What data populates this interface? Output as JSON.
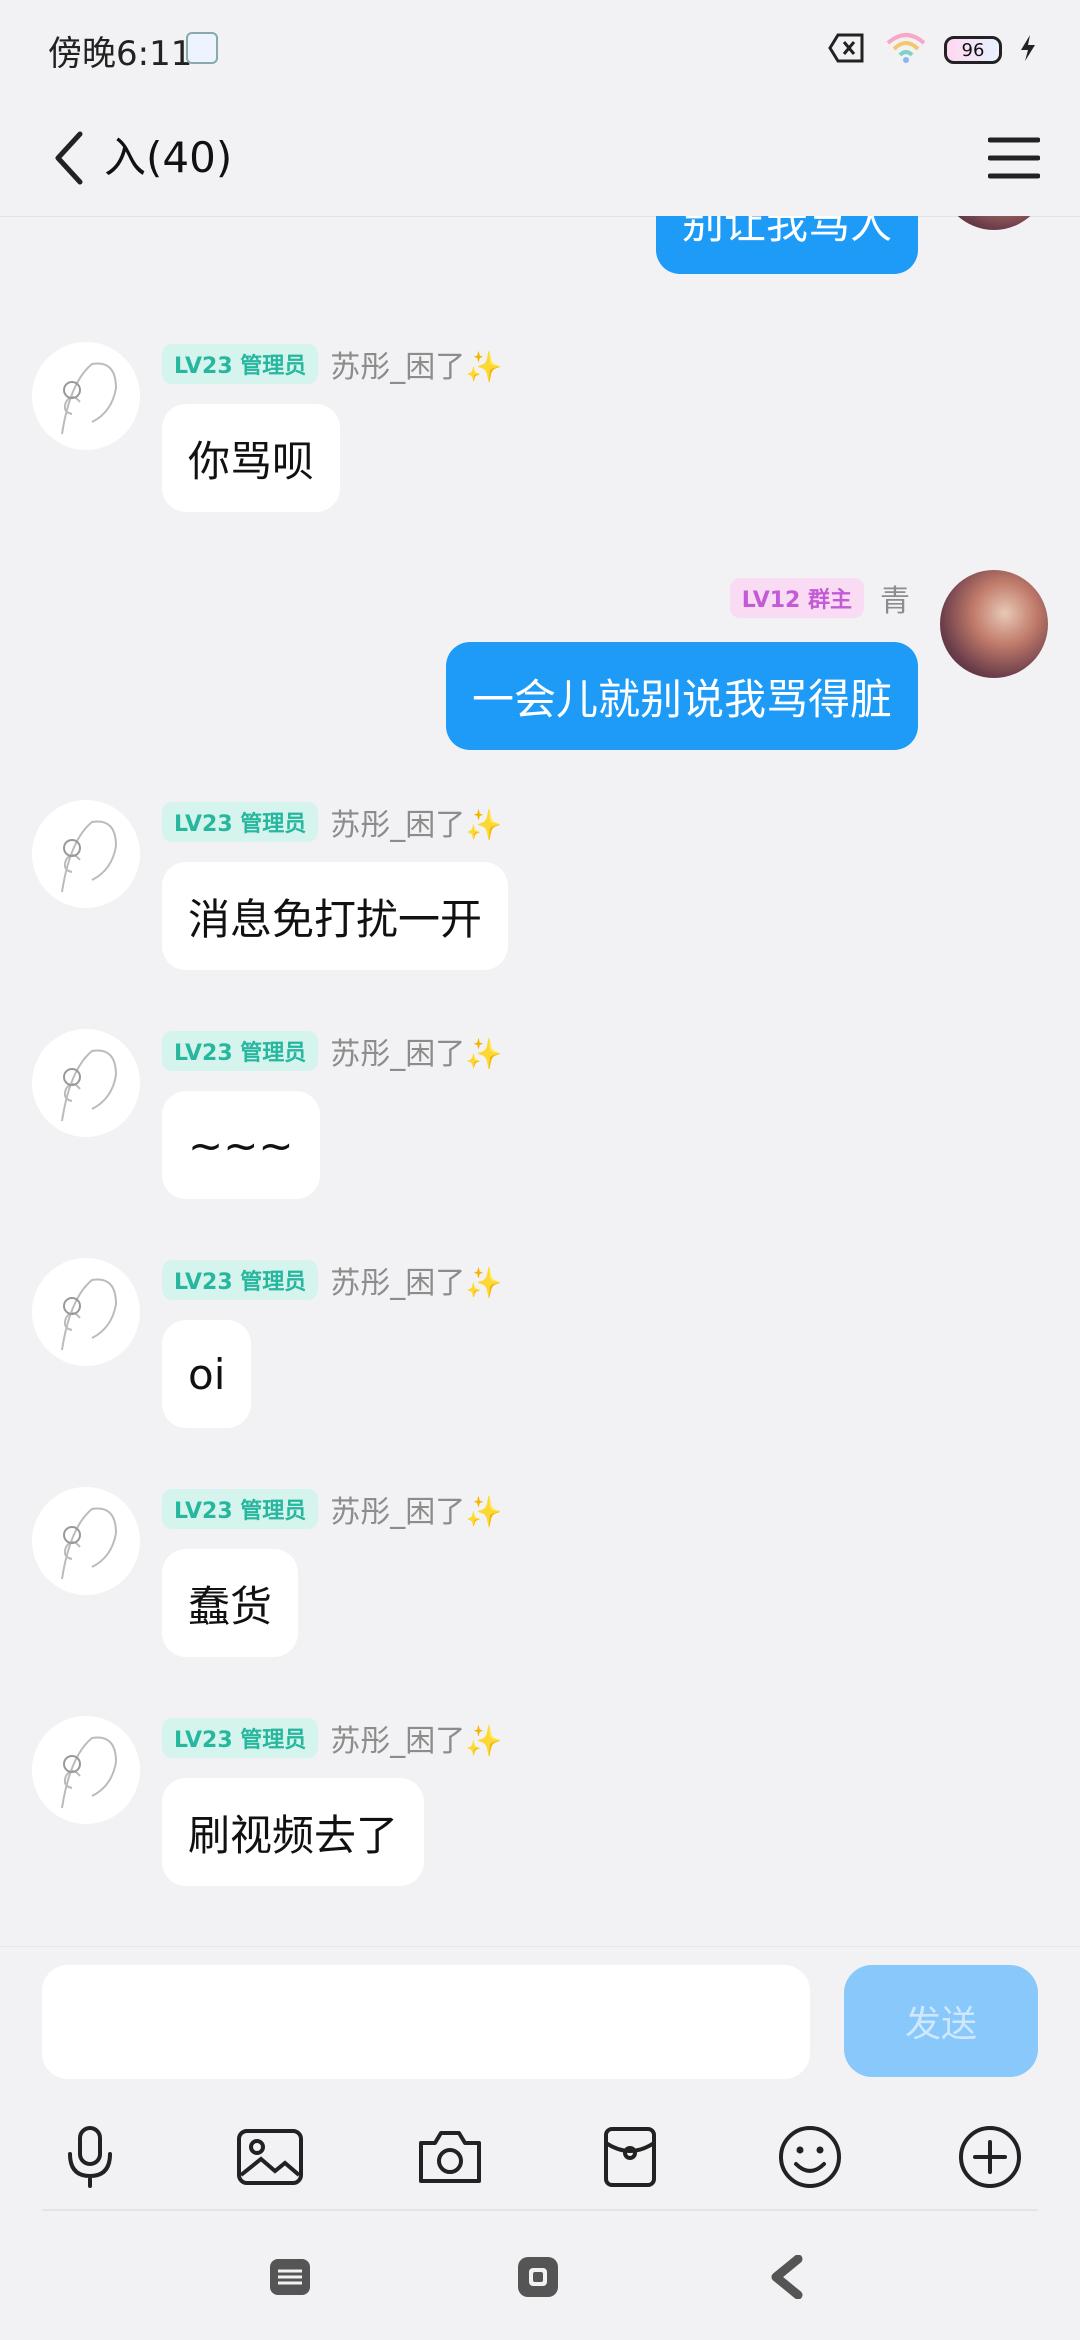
{
  "status_bar": {
    "time": "傍晚6:11",
    "battery": "96"
  },
  "header": {
    "title": "入(40)"
  },
  "messages": [
    {
      "side": "right",
      "text": "别让我骂人"
    },
    {
      "side": "left",
      "level": "LV23 管理员",
      "sender": "苏彤_困了✨",
      "text": "你骂呗"
    },
    {
      "side": "right",
      "level": "LV12 群主",
      "sender": "青",
      "text": "一会儿就别说我骂得脏"
    },
    {
      "side": "left",
      "level": "LV23 管理员",
      "sender": "苏彤_困了✨",
      "text": "消息免打扰一开"
    },
    {
      "side": "left",
      "level": "LV23 管理员",
      "sender": "苏彤_困了✨",
      "text": "~~~"
    },
    {
      "side": "left",
      "level": "LV23 管理员",
      "sender": "苏彤_困了✨",
      "text": "oi"
    },
    {
      "side": "left",
      "level": "LV23 管理员",
      "sender": "苏彤_困了✨",
      "text": "蠢货"
    },
    {
      "side": "left",
      "level": "LV23 管理员",
      "sender": "苏彤_困了✨",
      "text": "刷视频去了"
    }
  ],
  "input": {
    "placeholder": "",
    "send_label": "发送"
  },
  "toolbar_icons": [
    "microphone-icon",
    "image-icon",
    "camera-icon",
    "red-packet-icon",
    "emoji-icon",
    "plus-icon"
  ],
  "nav_icons": [
    "menu-icon",
    "home-icon",
    "back-icon"
  ],
  "colors": {
    "bubble_self": "#1e9bf7",
    "admin_badge": "#27b79e",
    "owner_badge": "#c35bd6",
    "send_button": "#89c8fb"
  }
}
